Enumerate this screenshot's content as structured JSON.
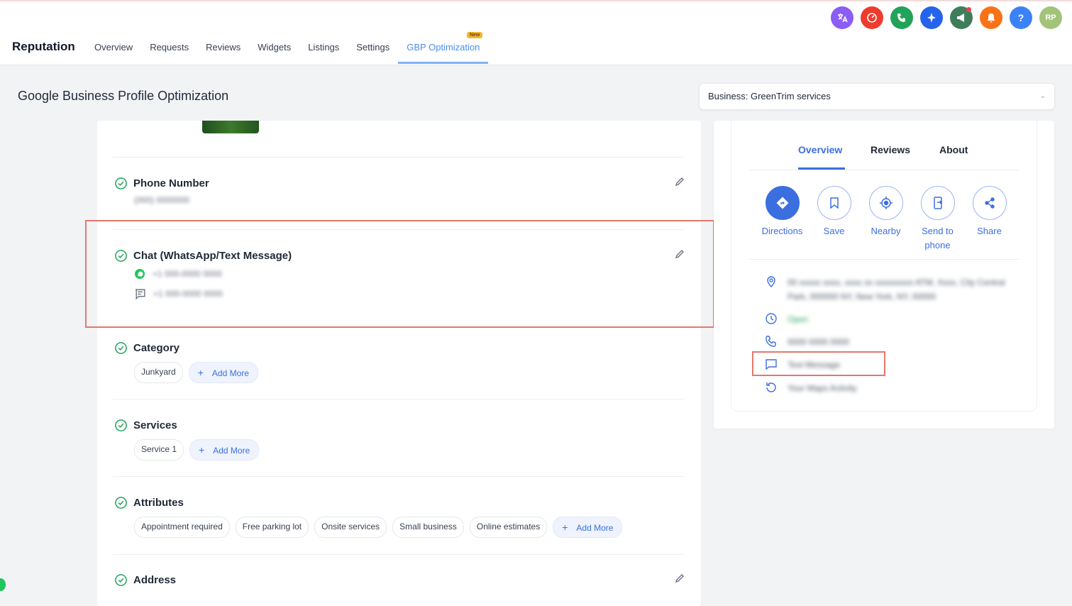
{
  "header": {
    "brand": "Reputation",
    "nav": [
      {
        "label": "Overview"
      },
      {
        "label": "Requests"
      },
      {
        "label": "Reviews"
      },
      {
        "label": "Widgets"
      },
      {
        "label": "Listings"
      },
      {
        "label": "Settings"
      },
      {
        "label": "GBP Optimization",
        "active": true,
        "badge": "New"
      }
    ],
    "icons": [
      {
        "name": "translate-icon",
        "color": "#8b5cf6"
      },
      {
        "name": "speedometer-icon",
        "color": "#ef3b2d"
      },
      {
        "name": "phone-icon",
        "color": "#22a35a"
      },
      {
        "name": "sparkle-icon",
        "color": "#2563eb"
      },
      {
        "name": "megaphone-icon",
        "color": "#3f7d5a"
      },
      {
        "name": "bell-icon",
        "color": "#f97316"
      },
      {
        "name": "help-icon",
        "color": "#3b82f6",
        "glyph": "?"
      },
      {
        "name": "avatar",
        "color": "#a3c27a",
        "glyph": "RP"
      }
    ]
  },
  "page": {
    "title": "Google Business Profile Optimization",
    "business_select": "Business: GreenTrim services"
  },
  "sections": {
    "phone": {
      "title": "Phone Number",
      "value": "(000) 0000000"
    },
    "chat": {
      "title": "Chat (WhatsApp/Text Message)",
      "whatsapp": "+1 000-0000 0000",
      "sms": "+1 000-0000 0000"
    },
    "category": {
      "title": "Category",
      "chips": [
        "Junkyard"
      ],
      "add_label": "Add More"
    },
    "services": {
      "title": "Services",
      "chips": [
        "Service 1"
      ],
      "add_label": "Add More"
    },
    "attributes": {
      "title": "Attributes",
      "chips": [
        "Appointment required",
        "Free parking lot",
        "Onsite services",
        "Small business",
        "Online estimates"
      ],
      "add_label": "Add More"
    },
    "address": {
      "title": "Address"
    }
  },
  "preview": {
    "tabs": [
      "Overview",
      "Reviews",
      "About"
    ],
    "actions": [
      {
        "label": "Directions",
        "icon": "directions-icon"
      },
      {
        "label": "Save",
        "icon": "bookmark-icon"
      },
      {
        "label": "Nearby",
        "icon": "nearby-icon"
      },
      {
        "label": "Send to phone",
        "icon": "send-to-phone-icon"
      },
      {
        "label": "Share",
        "icon": "share-icon"
      }
    ],
    "info": {
      "address": "00 xxxxx xxxx, xxxx xx xxxxxxxxx ATM, Xxxx, City Central Park, 000000 NY, New York, NY, 00000",
      "hours": "Open",
      "phone": "0000 0000 0000",
      "message": "Text Message",
      "activity": "Your Maps Activity"
    }
  }
}
